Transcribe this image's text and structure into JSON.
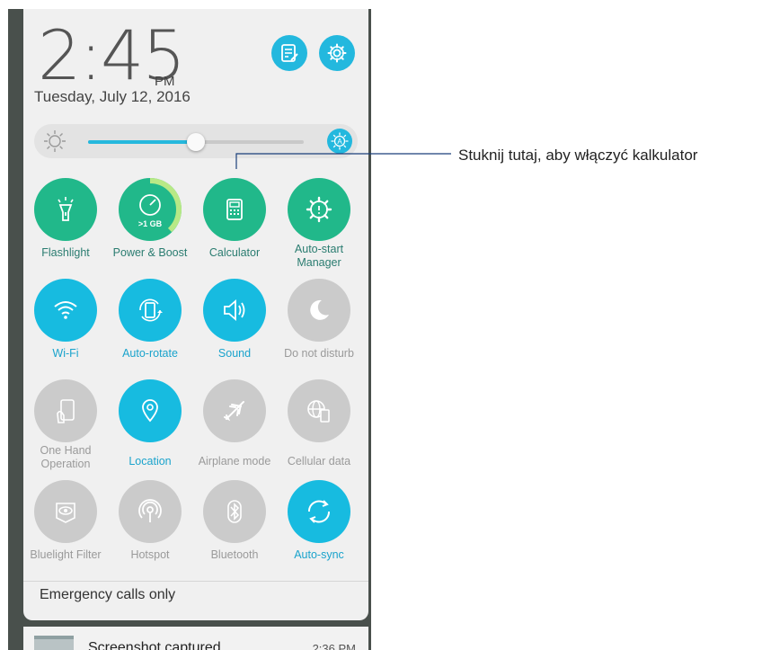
{
  "status": {
    "time": "2:45",
    "ampm": "PM",
    "date": "Tuesday, July 12, 2016"
  },
  "brightness": {
    "level_percent": 50,
    "auto": true
  },
  "tiles": [
    {
      "label": "Flashlight",
      "icon": "flashlight-icon",
      "state": "green"
    },
    {
      "label": "Power & Boost",
      "icon": "speedometer-icon",
      "state": "green",
      "sub": ">1 GB"
    },
    {
      "label": "Calculator",
      "icon": "calculator-icon",
      "state": "green"
    },
    {
      "label": "Auto-start Manager",
      "icon": "gear-manager-icon",
      "state": "green"
    },
    {
      "label": "Wi-Fi",
      "icon": "wifi-icon",
      "state": "blue"
    },
    {
      "label": "Auto-rotate",
      "icon": "rotate-icon",
      "state": "blue"
    },
    {
      "label": "Sound",
      "icon": "speaker-icon",
      "state": "blue"
    },
    {
      "label": "Do not disturb",
      "icon": "moon-icon",
      "state": "grey"
    },
    {
      "label": "One Hand Operation",
      "icon": "one-hand-icon",
      "state": "grey"
    },
    {
      "label": "Location",
      "icon": "location-pin-icon",
      "state": "blue"
    },
    {
      "label": "Airplane mode",
      "icon": "airplane-icon",
      "state": "grey"
    },
    {
      "label": "Cellular data",
      "icon": "cellular-globe-icon",
      "state": "grey"
    },
    {
      "label": "Bluelight Filter",
      "icon": "eye-filter-icon",
      "state": "grey"
    },
    {
      "label": "Hotspot",
      "icon": "hotspot-icon",
      "state": "grey"
    },
    {
      "label": "Bluetooth",
      "icon": "bluetooth-icon",
      "state": "grey"
    },
    {
      "label": "Auto-sync",
      "icon": "sync-icon",
      "state": "blue"
    }
  ],
  "footer": {
    "emergency": "Emergency calls only"
  },
  "notification": {
    "title": "Screenshot captured.",
    "time": "2:36 PM"
  },
  "callout": {
    "text": "Stuknij tutaj, aby włączyć kalkulator"
  },
  "colors": {
    "green": "#21b88a",
    "blue": "#17bbe0",
    "grey": "#cbcbcb"
  }
}
